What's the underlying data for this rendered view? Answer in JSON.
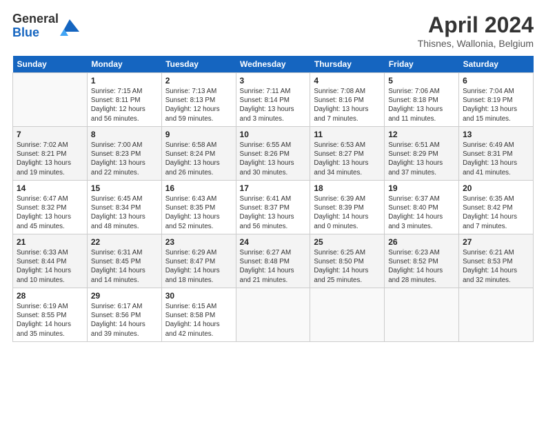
{
  "logo": {
    "general": "General",
    "blue": "Blue"
  },
  "title": "April 2024",
  "subtitle": "Thisnes, Wallonia, Belgium",
  "days_header": [
    "Sunday",
    "Monday",
    "Tuesday",
    "Wednesday",
    "Thursday",
    "Friday",
    "Saturday"
  ],
  "weeks": [
    [
      {
        "num": "",
        "info": ""
      },
      {
        "num": "1",
        "info": "Sunrise: 7:15 AM\nSunset: 8:11 PM\nDaylight: 12 hours\nand 56 minutes."
      },
      {
        "num": "2",
        "info": "Sunrise: 7:13 AM\nSunset: 8:13 PM\nDaylight: 12 hours\nand 59 minutes."
      },
      {
        "num": "3",
        "info": "Sunrise: 7:11 AM\nSunset: 8:14 PM\nDaylight: 13 hours\nand 3 minutes."
      },
      {
        "num": "4",
        "info": "Sunrise: 7:08 AM\nSunset: 8:16 PM\nDaylight: 13 hours\nand 7 minutes."
      },
      {
        "num": "5",
        "info": "Sunrise: 7:06 AM\nSunset: 8:18 PM\nDaylight: 13 hours\nand 11 minutes."
      },
      {
        "num": "6",
        "info": "Sunrise: 7:04 AM\nSunset: 8:19 PM\nDaylight: 13 hours\nand 15 minutes."
      }
    ],
    [
      {
        "num": "7",
        "info": "Sunrise: 7:02 AM\nSunset: 8:21 PM\nDaylight: 13 hours\nand 19 minutes."
      },
      {
        "num": "8",
        "info": "Sunrise: 7:00 AM\nSunset: 8:23 PM\nDaylight: 13 hours\nand 22 minutes."
      },
      {
        "num": "9",
        "info": "Sunrise: 6:58 AM\nSunset: 8:24 PM\nDaylight: 13 hours\nand 26 minutes."
      },
      {
        "num": "10",
        "info": "Sunrise: 6:55 AM\nSunset: 8:26 PM\nDaylight: 13 hours\nand 30 minutes."
      },
      {
        "num": "11",
        "info": "Sunrise: 6:53 AM\nSunset: 8:27 PM\nDaylight: 13 hours\nand 34 minutes."
      },
      {
        "num": "12",
        "info": "Sunrise: 6:51 AM\nSunset: 8:29 PM\nDaylight: 13 hours\nand 37 minutes."
      },
      {
        "num": "13",
        "info": "Sunrise: 6:49 AM\nSunset: 8:31 PM\nDaylight: 13 hours\nand 41 minutes."
      }
    ],
    [
      {
        "num": "14",
        "info": "Sunrise: 6:47 AM\nSunset: 8:32 PM\nDaylight: 13 hours\nand 45 minutes."
      },
      {
        "num": "15",
        "info": "Sunrise: 6:45 AM\nSunset: 8:34 PM\nDaylight: 13 hours\nand 48 minutes."
      },
      {
        "num": "16",
        "info": "Sunrise: 6:43 AM\nSunset: 8:35 PM\nDaylight: 13 hours\nand 52 minutes."
      },
      {
        "num": "17",
        "info": "Sunrise: 6:41 AM\nSunset: 8:37 PM\nDaylight: 13 hours\nand 56 minutes."
      },
      {
        "num": "18",
        "info": "Sunrise: 6:39 AM\nSunset: 8:39 PM\nDaylight: 14 hours\nand 0 minutes."
      },
      {
        "num": "19",
        "info": "Sunrise: 6:37 AM\nSunset: 8:40 PM\nDaylight: 14 hours\nand 3 minutes."
      },
      {
        "num": "20",
        "info": "Sunrise: 6:35 AM\nSunset: 8:42 PM\nDaylight: 14 hours\nand 7 minutes."
      }
    ],
    [
      {
        "num": "21",
        "info": "Sunrise: 6:33 AM\nSunset: 8:44 PM\nDaylight: 14 hours\nand 10 minutes."
      },
      {
        "num": "22",
        "info": "Sunrise: 6:31 AM\nSunset: 8:45 PM\nDaylight: 14 hours\nand 14 minutes."
      },
      {
        "num": "23",
        "info": "Sunrise: 6:29 AM\nSunset: 8:47 PM\nDaylight: 14 hours\nand 18 minutes."
      },
      {
        "num": "24",
        "info": "Sunrise: 6:27 AM\nSunset: 8:48 PM\nDaylight: 14 hours\nand 21 minutes."
      },
      {
        "num": "25",
        "info": "Sunrise: 6:25 AM\nSunset: 8:50 PM\nDaylight: 14 hours\nand 25 minutes."
      },
      {
        "num": "26",
        "info": "Sunrise: 6:23 AM\nSunset: 8:52 PM\nDaylight: 14 hours\nand 28 minutes."
      },
      {
        "num": "27",
        "info": "Sunrise: 6:21 AM\nSunset: 8:53 PM\nDaylight: 14 hours\nand 32 minutes."
      }
    ],
    [
      {
        "num": "28",
        "info": "Sunrise: 6:19 AM\nSunset: 8:55 PM\nDaylight: 14 hours\nand 35 minutes."
      },
      {
        "num": "29",
        "info": "Sunrise: 6:17 AM\nSunset: 8:56 PM\nDaylight: 14 hours\nand 39 minutes."
      },
      {
        "num": "30",
        "info": "Sunrise: 6:15 AM\nSunset: 8:58 PM\nDaylight: 14 hours\nand 42 minutes."
      },
      {
        "num": "",
        "info": ""
      },
      {
        "num": "",
        "info": ""
      },
      {
        "num": "",
        "info": ""
      },
      {
        "num": "",
        "info": ""
      }
    ]
  ]
}
